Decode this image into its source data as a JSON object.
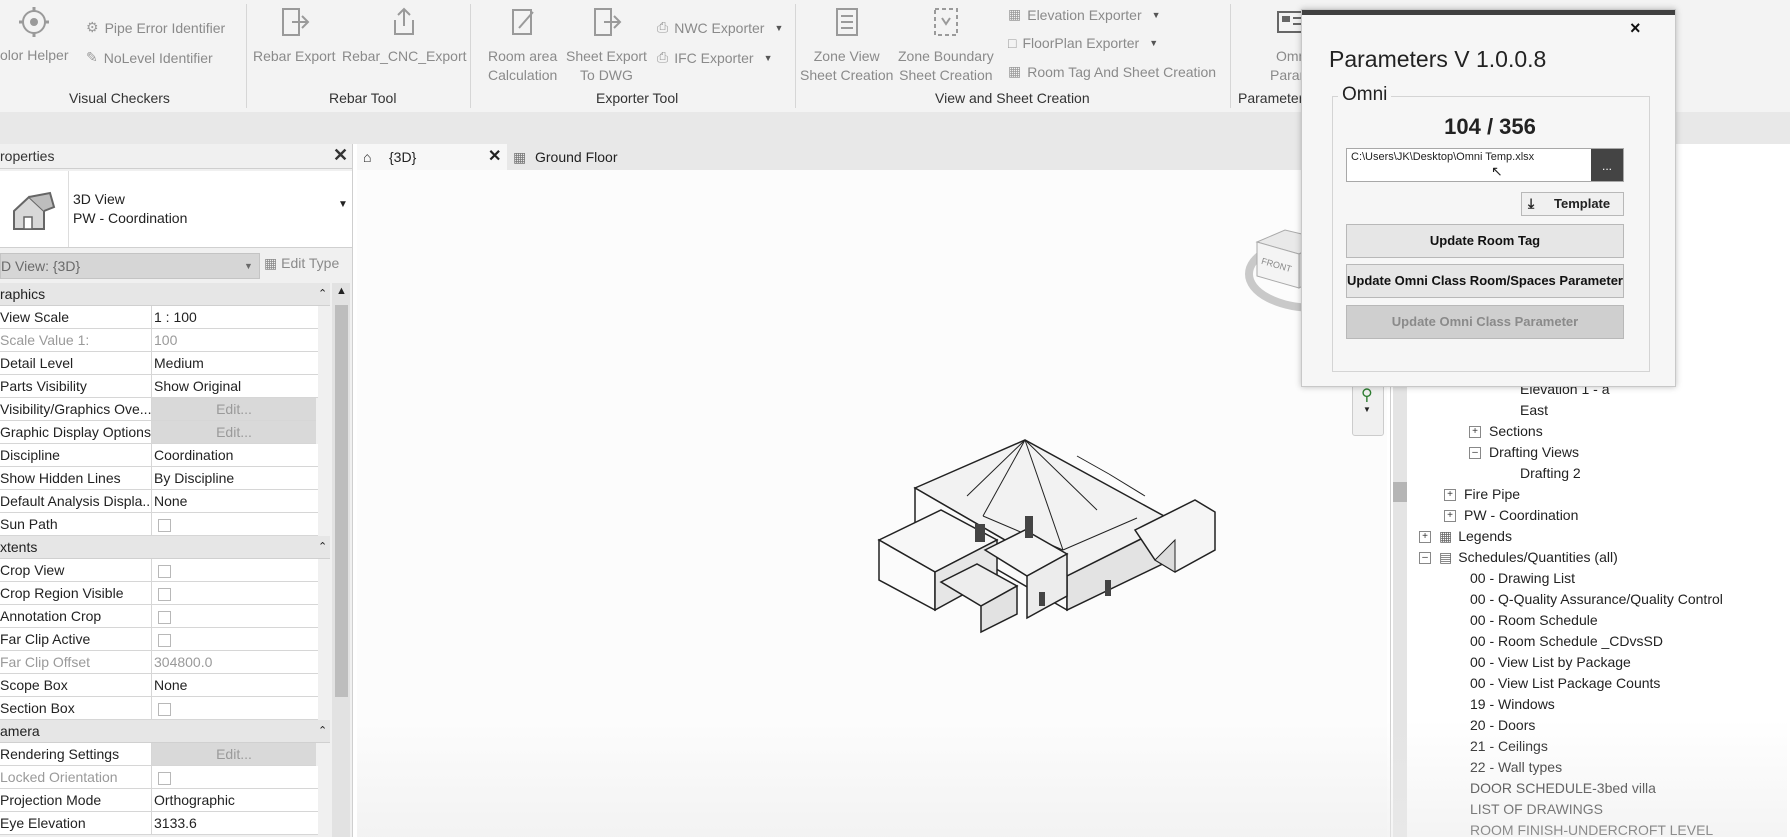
{
  "ribbon": {
    "groups": [
      {
        "label": "Visual Checkers"
      },
      {
        "label": "Rebar Tool"
      },
      {
        "label": "Exporter Tool"
      },
      {
        "label": "View and Sheet Creation"
      },
      {
        "label": "Parameter"
      }
    ],
    "color_helper": "olor Helper",
    "pipe_error": "Pipe Error Identifier",
    "nolevel": "NoLevel Identifier",
    "rebar_export": "Rebar Export",
    "rebar_cnc": "Rebar_CNC_Export",
    "room_area_1": "Room area",
    "room_area_2": "Calculation",
    "sheet_export_1": "Sheet Export",
    "sheet_export_2": "To DWG",
    "nwc": "NWC Exporter",
    "ifc": "IFC Exporter",
    "zone_view_1": "Zone View",
    "zone_view_2": "Sheet Creation",
    "zone_boundary_1": "Zone Boundary",
    "zone_boundary_2": "Sheet Creation",
    "elevation_exporter": "Elevation Exporter",
    "floorplan_exporter": "FloorPlan Exporter",
    "room_tag_sheet": "Room Tag And Sheet Creation",
    "omni_1": "Omn",
    "omni_2": "Parame"
  },
  "properties": {
    "title": "roperties",
    "type_line1": "3D View",
    "type_line2": "PW - Coordination",
    "view_selector": "D View: {3D}",
    "edit_type": "Edit Type",
    "sections": {
      "graphics": "raphics",
      "extents": "xtents",
      "camera": "amera"
    },
    "rows": {
      "view_scale": {
        "name": "View Scale",
        "value": "1 : 100"
      },
      "scale_value": {
        "name": "Scale Value    1:",
        "value": "100"
      },
      "detail_level": {
        "name": "Detail Level",
        "value": "Medium"
      },
      "parts_visibility": {
        "name": "Parts Visibility",
        "value": "Show Original"
      },
      "vg_overrides": {
        "name": "Visibility/Graphics Ove...",
        "value": "Edit..."
      },
      "graphic_display": {
        "name": "Graphic Display Options",
        "value": "Edit..."
      },
      "discipline": {
        "name": "Discipline",
        "value": "Coordination"
      },
      "hidden_lines": {
        "name": "Show Hidden Lines",
        "value": "By Discipline"
      },
      "analysis_display": {
        "name": "Default Analysis Displa...",
        "value": "None"
      },
      "sun_path": {
        "name": "Sun Path",
        "value": ""
      },
      "crop_view": {
        "name": "Crop View",
        "value": ""
      },
      "crop_region": {
        "name": "Crop Region Visible",
        "value": ""
      },
      "annotation_crop": {
        "name": "Annotation Crop",
        "value": ""
      },
      "far_clip_active": {
        "name": "Far Clip Active",
        "value": ""
      },
      "far_clip_offset": {
        "name": "Far Clip Offset",
        "value": "304800.0"
      },
      "scope_box": {
        "name": "Scope Box",
        "value": "None"
      },
      "section_box": {
        "name": "Section Box",
        "value": ""
      },
      "rendering": {
        "name": "Rendering Settings",
        "value": "Edit..."
      },
      "locked_orientation": {
        "name": "Locked Orientation",
        "value": ""
      },
      "projection_mode": {
        "name": "Projection Mode",
        "value": "Orthographic"
      },
      "eye_elevation": {
        "name": "Eye Elevation",
        "value": "3133.6"
      }
    }
  },
  "tabs": {
    "tab1": "{3D}",
    "tab2": "Ground Floor"
  },
  "browser": {
    "elevation_a": "Elevation 1 - a",
    "east": "East",
    "sections": "Sections",
    "drafting_views": "Drafting Views",
    "drafting_2": "Drafting 2",
    "fire_pipe": "Fire Pipe",
    "pw_coordination": "PW - Coordination",
    "legends": "Legends",
    "schedules": "Schedules/Quantities (all)",
    "items": [
      "00 - Drawing List",
      "00 - Q-Quality Assurance/Quality Control",
      "00 - Room Schedule",
      "00 - Room Schedule _CDvsSD",
      "00 - View List by Package",
      "00 - View List Package Counts",
      "19 - Windows",
      "20 - Doors",
      "21 - Ceilings",
      "22 - Wall types",
      "DOOR SCHEDULE-3bed villa",
      "LIST OF DRAWINGS",
      "ROOM FINISH-UNDERCROFT LEVEL"
    ]
  },
  "dialog": {
    "title": "Parameters V 1.0.0.8",
    "group_label": "Omni",
    "counter": "104 / 356",
    "file_path": "C:\\Users\\JK\\Desktop\\Omni Temp.xlsx",
    "browse_label": "...",
    "template_label": "Template",
    "btn_room_tag": "Update Room Tag",
    "btn_room_spaces": "Update Omni Class Room/Spaces Parameter",
    "btn_omni_param": "Update Omni Class Parameter",
    "close": "×"
  },
  "viewcube": {
    "front": "FRONT"
  },
  "colors": {
    "ribbon_bg": "#f3f3f3",
    "panel_bg": "#f0f0f0",
    "dialog_bg": "#f6f6f6",
    "disabled_btn": "#cfcfcf"
  }
}
